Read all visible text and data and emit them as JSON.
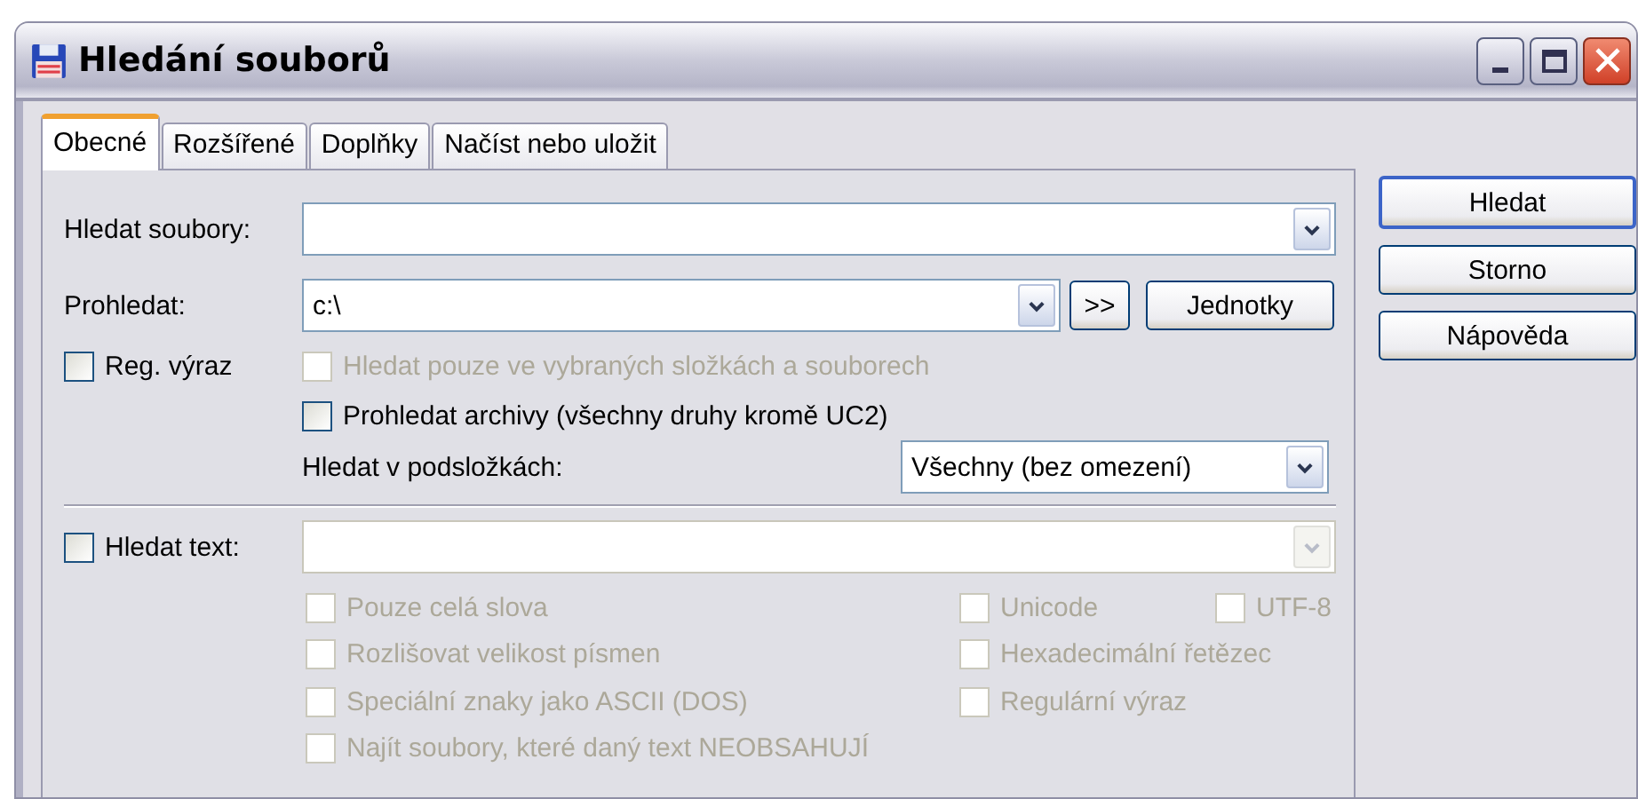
{
  "window": {
    "title": "Hledání souborů"
  },
  "tabs": [
    {
      "label": "Obecné",
      "selected": true
    },
    {
      "label": "Rozšířené",
      "selected": false
    },
    {
      "label": "Doplňky",
      "selected": false
    },
    {
      "label": "Načíst nebo uložit",
      "selected": false
    }
  ],
  "search_files": {
    "label": "Hledat soubory:"
  },
  "search_in": {
    "label": "Prohledat:",
    "value": "c:\\",
    "buttons": [
      ">>",
      "Jednotky"
    ]
  },
  "regex": {
    "label": "Reg. výraz",
    "checked": false
  },
  "options": [
    {
      "label": "Hledat pouze ve vybraných složkách a souborech",
      "checked": false,
      "disabled": true
    },
    {
      "label": "Prohledat archivy (všechny druhy kromě UC2)",
      "checked": false,
      "disabled": false
    }
  ],
  "subfolders": {
    "label": "Hledat v podsložkách:",
    "value": "Všechny (bez omezení)"
  },
  "text_search": {
    "label": "Hledat text:",
    "checked": false,
    "field_disabled": true
  },
  "text_options": [
    [
      {
        "label": "Pouze celá slova",
        "checked": false,
        "disabled": true
      },
      {
        "label": "Unicode",
        "checked": false,
        "disabled": true
      },
      {
        "label": "UTF-8",
        "checked": false,
        "disabled": true
      }
    ],
    [
      {
        "label": "Rozlišovat velikost písmen",
        "checked": false,
        "disabled": true
      },
      {
        "label": "Hexadecimální řetězec",
        "checked": false,
        "disabled": true
      }
    ],
    [
      {
        "label": "Speciální znaky jako ASCII (DOS)",
        "checked": false,
        "disabled": true
      },
      {
        "label": "Regulární výraz",
        "checked": false,
        "disabled": true
      }
    ],
    [
      {
        "label": "Najít soubory, které daný text NEOBSAHUJÍ",
        "checked": false,
        "disabled": true
      }
    ]
  ],
  "buttons": [
    {
      "label": "Hledat",
      "default": true
    },
    {
      "label": "Storno",
      "default": false
    },
    {
      "label": "Nápověda",
      "default": false
    }
  ]
}
